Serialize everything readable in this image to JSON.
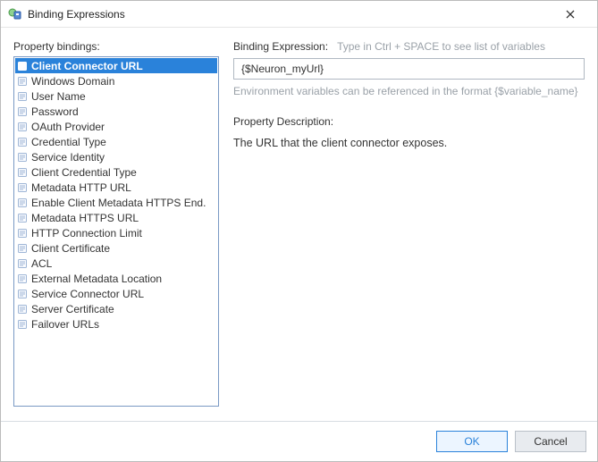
{
  "window": {
    "title": "Binding Expressions"
  },
  "left": {
    "label": "Property bindings:",
    "items": [
      "Client Connector URL",
      "Windows Domain",
      "User Name",
      "Password",
      "OAuth Provider",
      "Credential Type",
      "Service Identity",
      "Client Credential Type",
      "Metadata HTTP URL",
      "Enable Client Metadata HTTPS End.",
      "Metadata HTTPS URL",
      "HTTP Connection Limit",
      "Client Certificate",
      "ACL",
      "External Metadata Location",
      "Service Connector URL",
      "Server Certificate",
      "Failover URLs"
    ],
    "selected_index": 0
  },
  "right": {
    "expr_label": "Binding Expression:",
    "hint": "Type in Ctrl + SPACE to see list of variables",
    "expr_value": "{$Neuron_myUrl}",
    "help": "Environment variables can be referenced in the format {$variable_name}",
    "desc_label": "Property Description:",
    "desc_text": "The URL that the client connector exposes."
  },
  "footer": {
    "ok": "OK",
    "cancel": "Cancel"
  }
}
